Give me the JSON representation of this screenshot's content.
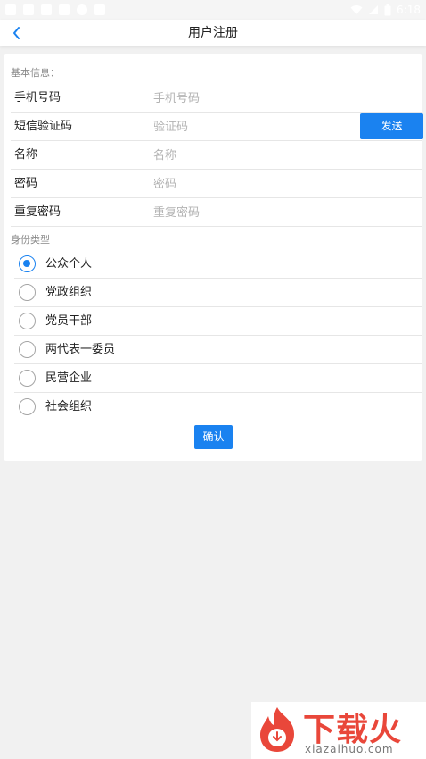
{
  "status_bar": {
    "time": "6:18"
  },
  "nav": {
    "title": "用户注册",
    "back_icon": "chevron-left-icon"
  },
  "basic_info": {
    "section_label": "基本信息：",
    "fields": [
      {
        "label": "手机号码",
        "placeholder": "手机号码",
        "value": ""
      },
      {
        "label": "短信验证码",
        "placeholder": "验证码",
        "value": ""
      },
      {
        "label": "名称",
        "placeholder": "名称",
        "value": ""
      },
      {
        "label": "密码",
        "placeholder": "密码",
        "value": ""
      },
      {
        "label": "重复密码",
        "placeholder": "重复密码",
        "value": ""
      }
    ],
    "send_label": "发送"
  },
  "identity": {
    "section_label": "身份类型",
    "options": [
      {
        "label": "公众个人",
        "selected": true
      },
      {
        "label": "党政组织",
        "selected": false
      },
      {
        "label": "党员干部",
        "selected": false
      },
      {
        "label": "两代表一委员",
        "selected": false
      },
      {
        "label": "民营企业",
        "selected": false
      },
      {
        "label": "社会组织",
        "selected": false
      }
    ]
  },
  "confirm_label": "确认",
  "watermark": {
    "title": "下载火",
    "subtitle": "xiazaihuo.com"
  },
  "colors": {
    "accent": "#1a82f0",
    "watermark": "#e9473a"
  }
}
